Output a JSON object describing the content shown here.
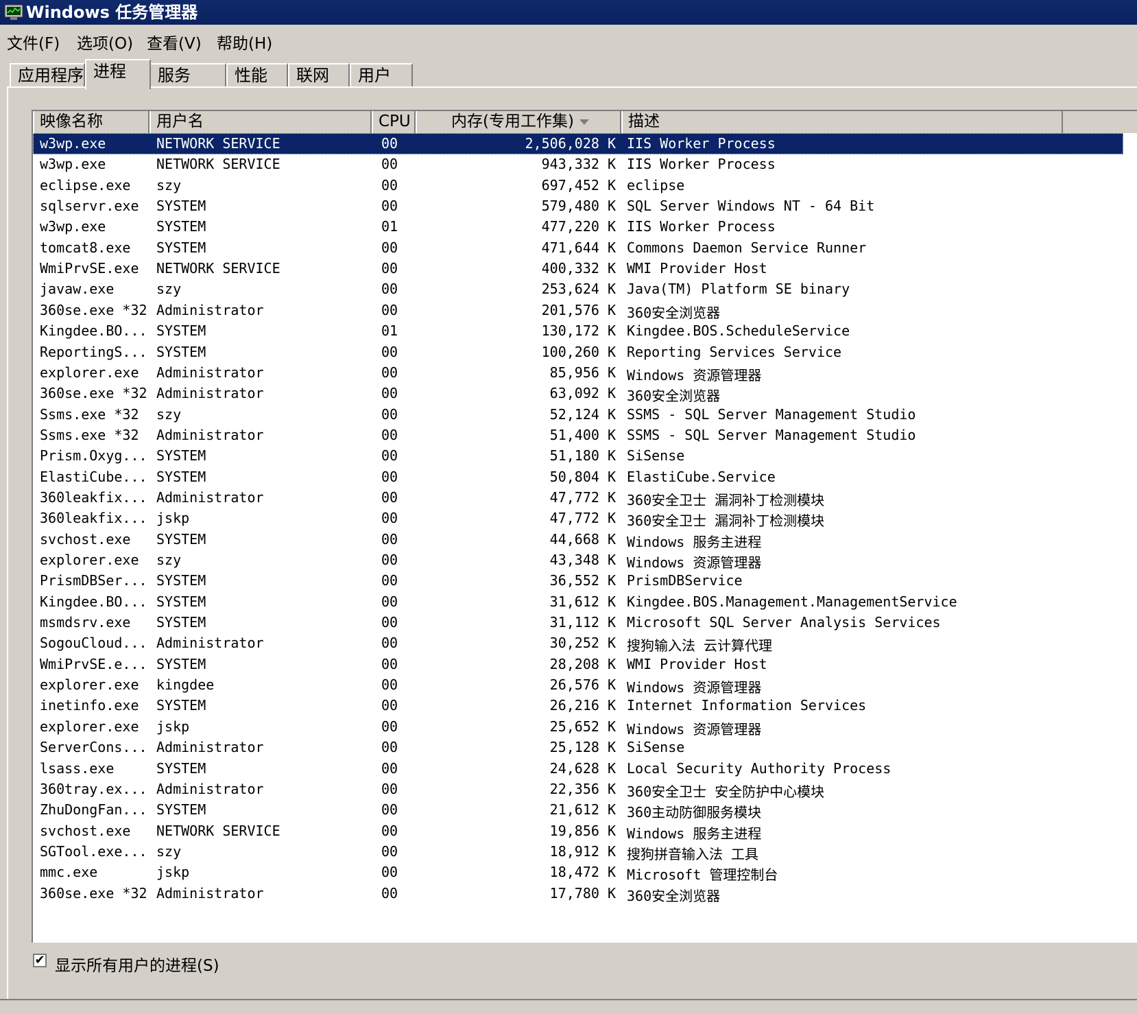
{
  "window": {
    "title": "Windows 任务管理器"
  },
  "menu": [
    "文件(F)",
    "选项(O)",
    "查看(V)",
    "帮助(H)"
  ],
  "tabs": [
    "应用程序",
    "进程",
    "服务",
    "性能",
    "联网",
    "用户"
  ],
  "active_tab": "进程",
  "columns": [
    "映像名称",
    "用户名",
    "CPU",
    "内存(专用工作集)",
    "描述"
  ],
  "processes": [
    {
      "name": "w3wp.exe",
      "user": "NETWORK SERVICE",
      "cpu": "00",
      "mem": "2,506,028 K",
      "desc": "IIS Worker Process"
    },
    {
      "name": "w3wp.exe",
      "user": "NETWORK SERVICE",
      "cpu": "00",
      "mem": "943,332 K",
      "desc": "IIS Worker Process"
    },
    {
      "name": "eclipse.exe",
      "user": "szy",
      "cpu": "00",
      "mem": "697,452 K",
      "desc": "eclipse"
    },
    {
      "name": "sqlservr.exe",
      "user": "SYSTEM",
      "cpu": "00",
      "mem": "579,480 K",
      "desc": "SQL Server Windows NT - 64 Bit"
    },
    {
      "name": "w3wp.exe",
      "user": "SYSTEM",
      "cpu": "01",
      "mem": "477,220 K",
      "desc": "IIS Worker Process"
    },
    {
      "name": "tomcat8.exe",
      "user": "SYSTEM",
      "cpu": "00",
      "mem": "471,644 K",
      "desc": "Commons Daemon Service Runner"
    },
    {
      "name": "WmiPrvSE.exe",
      "user": "NETWORK SERVICE",
      "cpu": "00",
      "mem": "400,332 K",
      "desc": "WMI Provider Host"
    },
    {
      "name": "javaw.exe",
      "user": "szy",
      "cpu": "00",
      "mem": "253,624 K",
      "desc": "Java(TM) Platform SE binary"
    },
    {
      "name": "360se.exe *32",
      "user": "Administrator",
      "cpu": "00",
      "mem": "201,576 K",
      "desc": "360安全浏览器"
    },
    {
      "name": "Kingdee.BO...",
      "user": "SYSTEM",
      "cpu": "01",
      "mem": "130,172 K",
      "desc": "Kingdee.BOS.ScheduleService"
    },
    {
      "name": "ReportingS...",
      "user": "SYSTEM",
      "cpu": "00",
      "mem": "100,260 K",
      "desc": "Reporting Services Service"
    },
    {
      "name": "explorer.exe",
      "user": "Administrator",
      "cpu": "00",
      "mem": "85,956 K",
      "desc": "Windows 资源管理器"
    },
    {
      "name": "360se.exe *32",
      "user": "Administrator",
      "cpu": "00",
      "mem": "63,092 K",
      "desc": "360安全浏览器"
    },
    {
      "name": "Ssms.exe *32",
      "user": "szy",
      "cpu": "00",
      "mem": "52,124 K",
      "desc": "SSMS - SQL Server Management Studio"
    },
    {
      "name": "Ssms.exe *32",
      "user": "Administrator",
      "cpu": "00",
      "mem": "51,400 K",
      "desc": "SSMS - SQL Server Management Studio"
    },
    {
      "name": "Prism.Oxyg...",
      "user": "SYSTEM",
      "cpu": "00",
      "mem": "51,180 K",
      "desc": "SiSense"
    },
    {
      "name": "ElastiCube...",
      "user": "SYSTEM",
      "cpu": "00",
      "mem": "50,804 K",
      "desc": "ElastiCube.Service"
    },
    {
      "name": "360leakfix...",
      "user": "Administrator",
      "cpu": "00",
      "mem": "47,772 K",
      "desc": "360安全卫士 漏洞补丁检测模块"
    },
    {
      "name": "360leakfix...",
      "user": "jskp",
      "cpu": "00",
      "mem": "47,772 K",
      "desc": "360安全卫士 漏洞补丁检测模块"
    },
    {
      "name": "svchost.exe",
      "user": "SYSTEM",
      "cpu": "00",
      "mem": "44,668 K",
      "desc": "Windows 服务主进程"
    },
    {
      "name": "explorer.exe",
      "user": "szy",
      "cpu": "00",
      "mem": "43,348 K",
      "desc": "Windows 资源管理器"
    },
    {
      "name": "PrismDBSer...",
      "user": "SYSTEM",
      "cpu": "00",
      "mem": "36,552 K",
      "desc": "PrismDBService"
    },
    {
      "name": "Kingdee.BO...",
      "user": "SYSTEM",
      "cpu": "00",
      "mem": "31,612 K",
      "desc": "Kingdee.BOS.Management.ManagementService"
    },
    {
      "name": "msmdsrv.exe",
      "user": "SYSTEM",
      "cpu": "00",
      "mem": "31,112 K",
      "desc": "Microsoft SQL Server Analysis Services"
    },
    {
      "name": "SogouCloud...",
      "user": "Administrator",
      "cpu": "00",
      "mem": "30,252 K",
      "desc": "搜狗输入法 云计算代理"
    },
    {
      "name": "WmiPrvSE.e...",
      "user": "SYSTEM",
      "cpu": "00",
      "mem": "28,208 K",
      "desc": "WMI Provider Host"
    },
    {
      "name": "explorer.exe",
      "user": "kingdee",
      "cpu": "00",
      "mem": "26,576 K",
      "desc": "Windows 资源管理器"
    },
    {
      "name": "inetinfo.exe",
      "user": "SYSTEM",
      "cpu": "00",
      "mem": "26,216 K",
      "desc": "Internet Information Services"
    },
    {
      "name": "explorer.exe",
      "user": "jskp",
      "cpu": "00",
      "mem": "25,652 K",
      "desc": "Windows 资源管理器"
    },
    {
      "name": "ServerCons...",
      "user": "Administrator",
      "cpu": "00",
      "mem": "25,128 K",
      "desc": "SiSense"
    },
    {
      "name": "lsass.exe",
      "user": "SYSTEM",
      "cpu": "00",
      "mem": "24,628 K",
      "desc": "Local Security Authority Process"
    },
    {
      "name": "360tray.ex...",
      "user": "Administrator",
      "cpu": "00",
      "mem": "22,356 K",
      "desc": "360安全卫士 安全防护中心模块"
    },
    {
      "name": "ZhuDongFan...",
      "user": "SYSTEM",
      "cpu": "00",
      "mem": "21,612 K",
      "desc": "360主动防御服务模块"
    },
    {
      "name": "svchost.exe",
      "user": "NETWORK SERVICE",
      "cpu": "00",
      "mem": "19,856 K",
      "desc": "Windows 服务主进程"
    },
    {
      "name": "SGTool.exe...",
      "user": "szy",
      "cpu": "00",
      "mem": "18,912 K",
      "desc": "搜狗拼音输入法 工具"
    },
    {
      "name": "mmc.exe",
      "user": "jskp",
      "cpu": "00",
      "mem": "18,472 K",
      "desc": "Microsoft 管理控制台"
    },
    {
      "name": "360se.exe *32",
      "user": "Administrator",
      "cpu": "00",
      "mem": "17,780 K",
      "desc": "360安全浏览器"
    }
  ],
  "selected_row": 0,
  "show_all_users": {
    "label": "显示所有用户的进程(S)",
    "checked": true,
    "check_glyph": "✔"
  },
  "icons": {
    "app_icon": "task-manager-icon",
    "sort": "sort-descending-arrow"
  }
}
